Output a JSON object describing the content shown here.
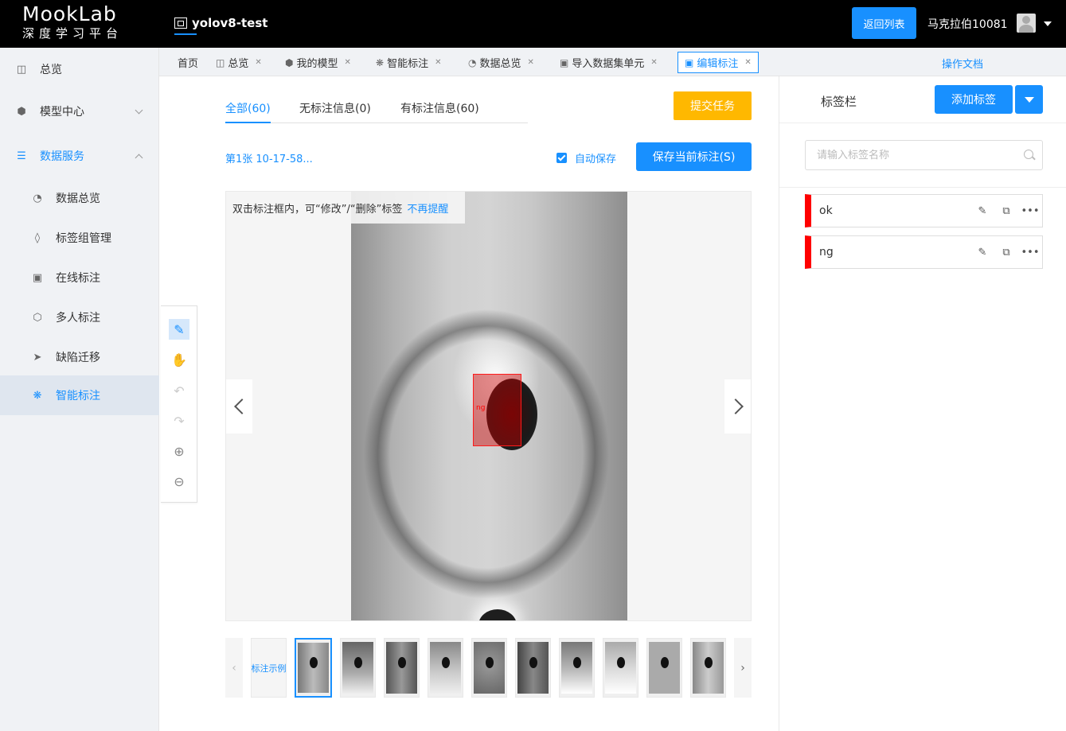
{
  "header": {
    "logo_main": "MookLab",
    "logo_sub": "深度学习平台",
    "project_name": "yolov8-test",
    "back_button": "返回列表",
    "username": "马克拉伯10081"
  },
  "sidebar": {
    "items": [
      {
        "label": "总览",
        "icon": "overview-icon"
      },
      {
        "label": "模型中心",
        "icon": "cube-icon"
      },
      {
        "label": "数据服务",
        "icon": "database-icon"
      },
      {
        "label": "数据总览",
        "icon": "pie-chart-icon"
      },
      {
        "label": "标签组管理",
        "icon": "tag-icon"
      },
      {
        "label": "在线标注",
        "icon": "text-box-icon"
      },
      {
        "label": "多人标注",
        "icon": "cubes-icon"
      },
      {
        "label": "缺陷迁移",
        "icon": "send-icon"
      },
      {
        "label": "智能标注",
        "icon": "aperture-icon"
      }
    ]
  },
  "tabs": {
    "items": [
      {
        "label": "首页"
      },
      {
        "label": "总览"
      },
      {
        "label": "我的模型"
      },
      {
        "label": "智能标注"
      },
      {
        "label": "数据总览"
      },
      {
        "label": "导入数据集单元"
      },
      {
        "label": "编辑标注"
      }
    ],
    "doc_link": "操作文档"
  },
  "main": {
    "filters": [
      {
        "label": "全部(60)"
      },
      {
        "label": "无标注信息(0)"
      },
      {
        "label": "有标注信息(60)"
      }
    ],
    "submit_button": "提交任务",
    "image_index": "第1张 10-17-58...",
    "autosave_label": "自动保存",
    "save_button": "保存当前标注(S)",
    "hint_text": "双击标注框内，可“修改”/“删除”标签",
    "hint_dismiss": "不再提醒",
    "bbox_label": "ng",
    "example_thumb": "标注示例"
  },
  "right_panel": {
    "title": "标签栏",
    "add_button": "添加标签",
    "search_placeholder": "请输入标签名称",
    "labels": [
      {
        "name": "ok",
        "color": "#ff0000"
      },
      {
        "name": "ng",
        "color": "#ff0000"
      }
    ]
  },
  "colors": {
    "accent": "#1890ff",
    "warning": "#ffb800",
    "label_marker": "#ff0000"
  }
}
